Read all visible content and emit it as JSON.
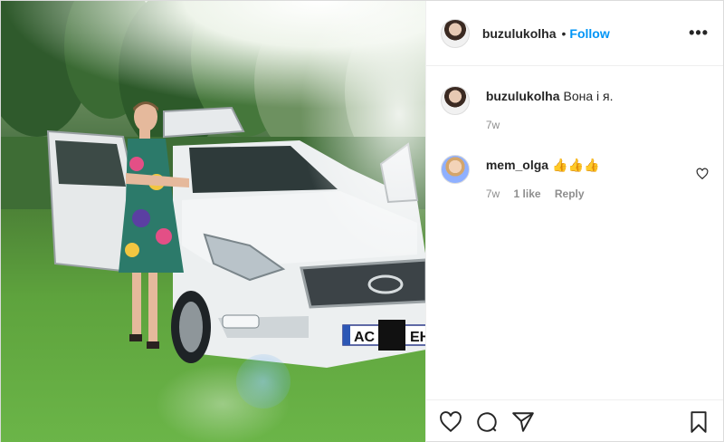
{
  "post": {
    "author": {
      "username": "buzulukolha",
      "follow_label": "Follow",
      "separator": "•"
    },
    "plate": {
      "left": "AC",
      "right": "EH"
    },
    "caption": {
      "username": "buzulukolha",
      "text": "Вона і я.",
      "time": "7w"
    },
    "comments": [
      {
        "username": "mem_olga",
        "text": "👍👍👍",
        "time": "7w",
        "likes": "1 like",
        "reply_label": "Reply"
      }
    ],
    "icons": {
      "more": "more-options-icon",
      "like": "heart-icon",
      "comment": "comment-icon",
      "share": "share-icon",
      "save": "bookmark-icon"
    }
  }
}
